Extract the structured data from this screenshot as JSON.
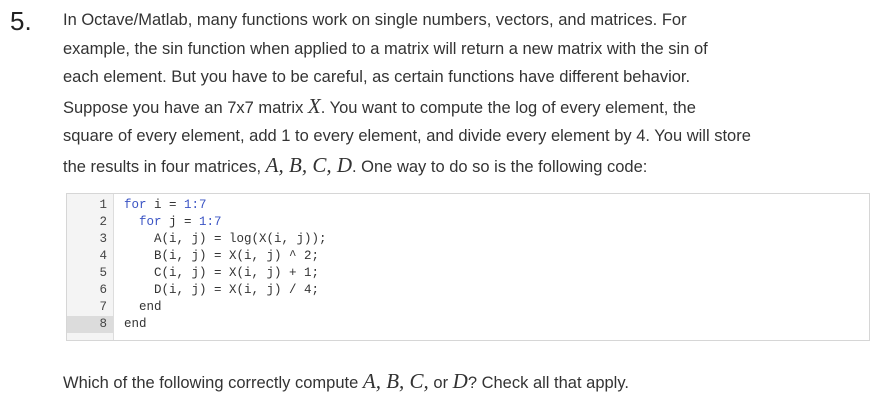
{
  "question_number": "5.",
  "intro": {
    "line1": "In Octave/Matlab, many functions work on single numbers, vectors, and matrices. For",
    "line2": "example, the sin function when applied to a matrix will return a new matrix with the sin of",
    "line3": "each element. But you have to be careful, as certain functions have different behavior.",
    "line4_pre": "Suppose you have an 7x7 matrix ",
    "line4_math": "X",
    "line4_post": ". You want to compute the log of every element, the",
    "line5": "square of every element, add 1 to every element, and divide every element by 4. You will store",
    "line6_pre": "the results in four matrices, ",
    "line6_math": "A, B, C, D",
    "line6_post": ". One way to do so is the following code:"
  },
  "code": {
    "line_numbers": [
      "1",
      "2",
      "3",
      "4",
      "5",
      "6",
      "7",
      "8"
    ],
    "lines": [
      {
        "kw": "for",
        "rest": " i = ",
        "num": "1:7",
        "tail": ""
      },
      {
        "indent": "  ",
        "kw": "for",
        "rest": " j = ",
        "num": "1:7",
        "tail": ""
      },
      {
        "text": "    A(i, j) = log(X(i, j));"
      },
      {
        "text": "    B(i, j) = X(i, j) ^ 2;"
      },
      {
        "text": "    C(i, j) = X(i, j) + 1;"
      },
      {
        "text": "    D(i, j) = X(i, j) / 4;"
      },
      {
        "text": "  end"
      },
      {
        "text": "end"
      }
    ]
  },
  "question": {
    "pre": "Which of the following correctly compute ",
    "math1": "A, B, C,",
    "mid": " or ",
    "math2": "D",
    "post": "? Check all that apply."
  }
}
